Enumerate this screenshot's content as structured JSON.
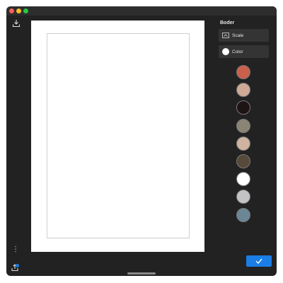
{
  "window": {
    "traffic_lights": [
      "close",
      "minimize",
      "maximize"
    ]
  },
  "toolbar": {
    "export_icon": "export-icon",
    "import_icon": "import-icon",
    "more_icon": "more-vertical-icon"
  },
  "panel": {
    "title": "Boder",
    "scale_label": "Scale",
    "color_label": "Color"
  },
  "swatches": [
    {
      "name": "red",
      "color": "#c9604b"
    },
    {
      "name": "peach",
      "color": "#cda996"
    },
    {
      "name": "black",
      "color": "#1e1414"
    },
    {
      "name": "olive-gray",
      "color": "#8b8474"
    },
    {
      "name": "sand",
      "color": "#cfb3a0"
    },
    {
      "name": "dark-brown",
      "color": "#574a3a"
    },
    {
      "name": "white",
      "color": "#ffffff"
    },
    {
      "name": "light-gray",
      "color": "#c3c3c6"
    },
    {
      "name": "slate-blue",
      "color": "#6b8694"
    }
  ],
  "colors": {
    "window_bg": "#222222",
    "accent": "#1a7ee6",
    "canvas": "#ffffff"
  }
}
